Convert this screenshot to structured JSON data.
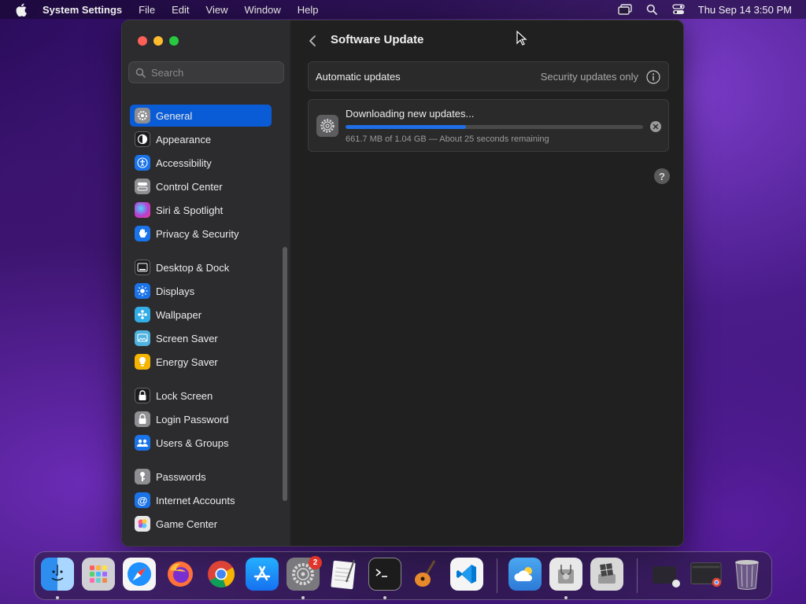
{
  "menubar": {
    "app_name": "System Settings",
    "items": [
      "File",
      "Edit",
      "View",
      "Window",
      "Help"
    ],
    "clock": "Thu Sep 14  3:50 PM"
  },
  "sidebar": {
    "search_placeholder": "Search",
    "items": [
      {
        "label": "General",
        "icon": "gear-icon",
        "color": "#8e8e93"
      },
      {
        "label": "Appearance",
        "icon": "appearance-icon",
        "color": "#1c1c1e"
      },
      {
        "label": "Accessibility",
        "icon": "accessibility-icon",
        "color": "#1a73e8"
      },
      {
        "label": "Control Center",
        "icon": "control-center-icon",
        "color": "#8e8e93"
      },
      {
        "label": "Siri & Spotlight",
        "icon": "siri-icon",
        "color": "#b43fd1"
      },
      {
        "label": "Privacy & Security",
        "icon": "hand-icon",
        "color": "#1a73e8"
      },
      {
        "label": "Desktop & Dock",
        "icon": "dock-icon",
        "color": "#1c1c1e"
      },
      {
        "label": "Displays",
        "icon": "sun-icon",
        "color": "#1a73e8"
      },
      {
        "label": "Wallpaper",
        "icon": "wallpaper-icon",
        "color": "#32ade6"
      },
      {
        "label": "Screen Saver",
        "icon": "screen-saver-icon",
        "color": "#4fb3e0"
      },
      {
        "label": "Energy Saver",
        "icon": "bulb-icon",
        "color": "#f4b400"
      },
      {
        "label": "Lock Screen",
        "icon": "lock-icon",
        "color": "#1c1c1e"
      },
      {
        "label": "Login Password",
        "icon": "login-lock-icon",
        "color": "#8e8e93"
      },
      {
        "label": "Users & Groups",
        "icon": "users-icon",
        "color": "#1a73e8"
      },
      {
        "label": "Passwords",
        "icon": "key-icon",
        "color": "#8e8e93"
      },
      {
        "label": "Internet Accounts",
        "icon": "at-icon",
        "color": "#1a73e8"
      },
      {
        "label": "Game Center",
        "icon": "game-center-icon",
        "color": "#e8e8e8"
      }
    ]
  },
  "main": {
    "title": "Software Update",
    "automatic_updates": {
      "label": "Automatic updates",
      "value": "Security updates only"
    },
    "download": {
      "title": "Downloading new updates...",
      "progress": 0.405,
      "detail": "661.7 MB of 1.04 GB — About 25 seconds remaining"
    },
    "help": "?"
  },
  "dock": {
    "apps": [
      {
        "name": "Finder",
        "color": "#3fa0f0"
      },
      {
        "name": "Launchpad",
        "color": "#d9d9d9"
      },
      {
        "name": "Safari",
        "color": "#1e90ff"
      },
      {
        "name": "Firefox",
        "color": "#ff7139"
      },
      {
        "name": "Chrome",
        "color": "#ffffff"
      },
      {
        "name": "App Store",
        "color": "#1c8cf5"
      },
      {
        "name": "System Settings",
        "color": "#8e8e93"
      },
      {
        "name": "TextEdit",
        "color": "#f0f0f0"
      },
      {
        "name": "Terminal",
        "color": "#1c1c1c"
      },
      {
        "name": "GarageBand",
        "color": "#e88a2b"
      },
      {
        "name": "Visual Studio Code",
        "color": "#0078d4"
      },
      {
        "name": "Weather",
        "color": "#3b8ee6"
      },
      {
        "name": "Disk Utility",
        "color": "#e0e0e0"
      },
      {
        "name": "Boot Camp Assistant",
        "color": "#d0d0d0"
      }
    ],
    "settings_badge": "2"
  }
}
